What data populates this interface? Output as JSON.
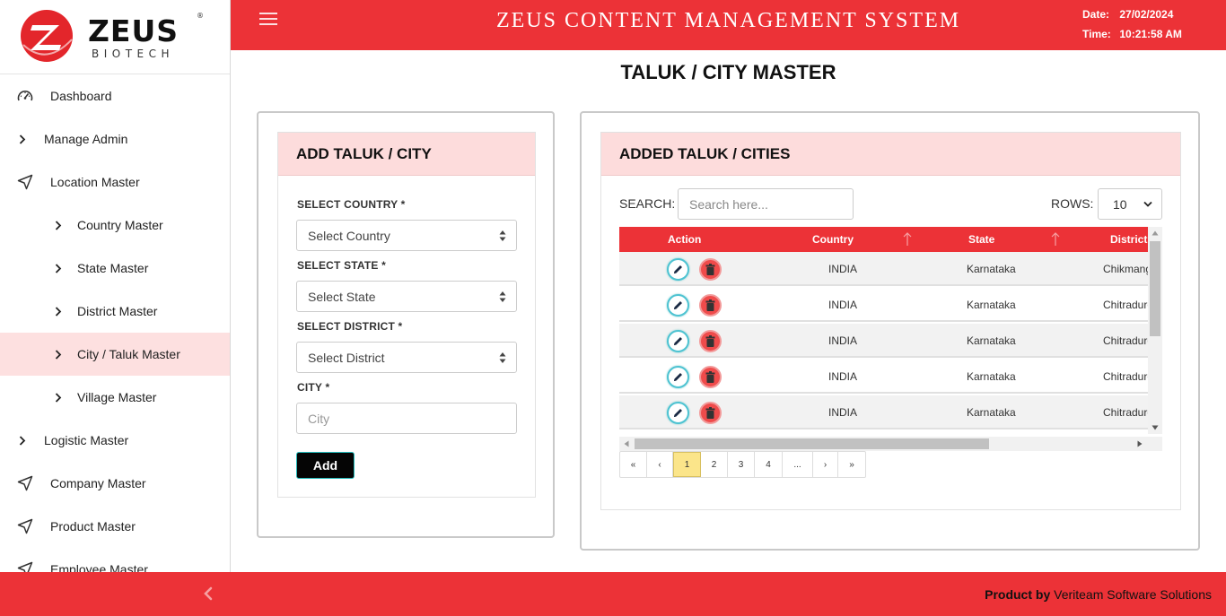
{
  "brand": {
    "name": "ZEUS",
    "tagline": "BIOTECH",
    "registered": "®"
  },
  "header": {
    "title": "ZEUS CONTENT MANAGEMENT SYSTEM",
    "date_label": "Date:",
    "date_value": "27/02/2024",
    "time_label": "Time:",
    "time_value": "10:21:58 AM"
  },
  "sidebar": {
    "items": [
      {
        "label": "Dashboard",
        "icon": "speedometer-icon",
        "level": "top"
      },
      {
        "label": "Manage Admin",
        "icon": "chevron-right-icon",
        "level": "top"
      },
      {
        "label": "Location Master",
        "icon": "send-icon",
        "level": "top"
      },
      {
        "label": "Country Master",
        "icon": "chevron-right-icon",
        "level": "sub"
      },
      {
        "label": "State Master",
        "icon": "chevron-right-icon",
        "level": "sub"
      },
      {
        "label": "District Master",
        "icon": "chevron-right-icon",
        "level": "sub"
      },
      {
        "label": "City / Taluk Master",
        "icon": "chevron-right-icon",
        "level": "sub",
        "active": true
      },
      {
        "label": "Village Master",
        "icon": "chevron-right-icon",
        "level": "sub"
      },
      {
        "label": "Logistic Master",
        "icon": "chevron-right-icon",
        "level": "top"
      },
      {
        "label": "Company Master",
        "icon": "send-icon",
        "level": "top"
      },
      {
        "label": "Product Master",
        "icon": "send-icon",
        "level": "top"
      },
      {
        "label": "Employee Master",
        "icon": "send-icon",
        "level": "top"
      }
    ]
  },
  "page": {
    "title": "TALUK / CITY MASTER"
  },
  "form": {
    "heading": "ADD TALUK / CITY",
    "country_label": "SELECT COUNTRY *",
    "country_value": "Select Country",
    "state_label": "SELECT STATE *",
    "state_value": "Select State",
    "district_label": "SELECT DISTRICT *",
    "district_value": "Select District",
    "city_label": "CITY *",
    "city_placeholder": "City",
    "add_label": "Add"
  },
  "list": {
    "heading": "ADDED TALUK / CITIES",
    "search_label": "SEARCH:",
    "search_placeholder": "Search here...",
    "rows_label": "ROWS:",
    "rows_value": "10",
    "columns": [
      "Action",
      "Country",
      "State",
      "District"
    ],
    "rows": [
      {
        "country": "INDIA",
        "state": "Karnataka",
        "district": "Chikmangaluru"
      },
      {
        "country": "INDIA",
        "state": "Karnataka",
        "district": "Chitradurga"
      },
      {
        "country": "INDIA",
        "state": "Karnataka",
        "district": "Chitradurga"
      },
      {
        "country": "INDIA",
        "state": "Karnataka",
        "district": "Chitradurga"
      },
      {
        "country": "INDIA",
        "state": "Karnataka",
        "district": "Chitradurga"
      }
    ],
    "pagination": [
      "«",
      "‹",
      "1",
      "2",
      "3",
      "4",
      "...",
      "›",
      "»"
    ],
    "current_page": "1"
  },
  "footer": {
    "credit_prefix": "Product by",
    "credit_company": "Veriteam Software Solutions"
  },
  "colors": {
    "brand_red": "#ec3237",
    "active_bg": "#fde0e0",
    "card_head_bg": "#fddcdc",
    "page_active": "#fbe58a"
  }
}
